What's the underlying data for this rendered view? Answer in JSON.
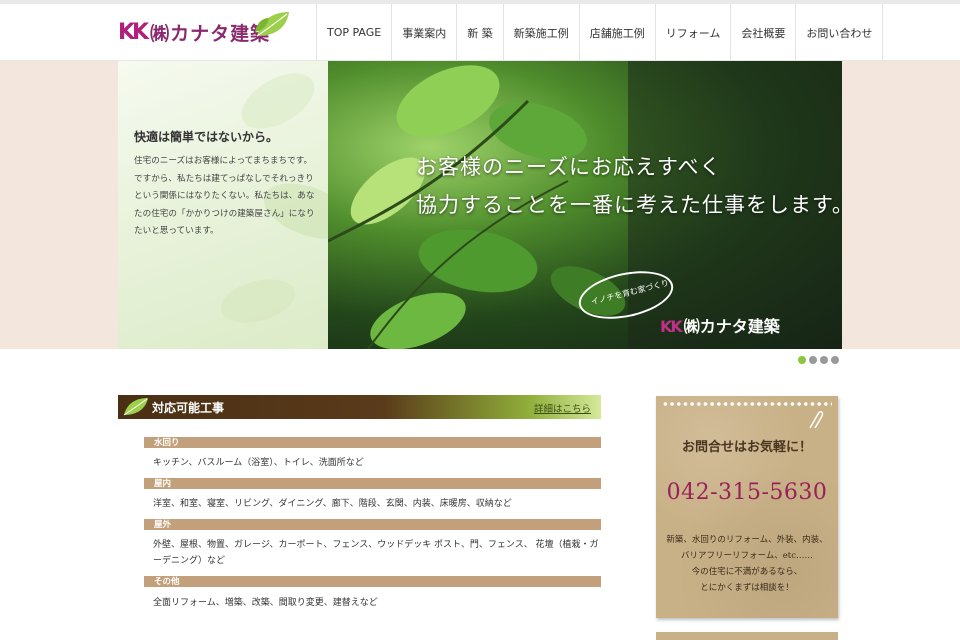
{
  "header": {
    "logo_mark": "KK",
    "logo_text": "㈱カナタ建築",
    "nav": [
      "TOP PAGE",
      "事業案内",
      "新 築",
      "新築施工例",
      "店舗施工例",
      "リフォーム",
      "会社概要",
      "お問い合わせ"
    ]
  },
  "hero": {
    "heading": "快適は簡単ではないから。",
    "body": "住宅のニーズはお客様によってまちまちです。ですから、私たちは建てっぱなしでそれっきりという関係にはなりたくない。私たちは、あなたの住宅の「かかりつけの建築屋さん」になりたいと思っています。",
    "catch_line1": "お客様のニーズにお応えすべく",
    "catch_line2": "協力することを一番に考えた仕事をします。",
    "bubble_text": "イノチを育む家づくり",
    "photo_logo_mark": "KK",
    "photo_logo_text": "㈱カナタ建築",
    "slides": 4,
    "active_slide": 0
  },
  "services": {
    "title": "対応可能工事",
    "detail_link": "詳細はこちら",
    "categories": [
      {
        "label": "水回り",
        "items": "キッチン、バスルーム（浴室）、トイレ、洗面所など"
      },
      {
        "label": "屋内",
        "items": "洋室、和室、寝室、リビング、ダイニング、廊下、階段、玄関、内装、床暖房、収納など"
      },
      {
        "label": "屋外",
        "items": "外壁、屋根、物置、ガレージ、カーポート、フェンス、ウッドデッキ ポスト、門、フェンス、 花壇（植栽・ガーデニング）など"
      },
      {
        "label": "その他",
        "items": "全面リフォーム、増築、改築、間取り変更、建替えなど"
      }
    ]
  },
  "contact": {
    "title": "お問合せはお気軽に！",
    "phone": "042-315-5630",
    "text_lines": [
      "新築、水回りのリフォーム、外装、内装、",
      "バリアフリーリフォーム、etc……",
      "今の住宅に不満があるなら、",
      "とにかくまずは相談を！"
    ]
  },
  "colors": {
    "brand": "#9a1f5a",
    "accent_green": "#8cc63f",
    "hero_bg": "#f3e6dc",
    "category_bar": "#c2a07b"
  }
}
